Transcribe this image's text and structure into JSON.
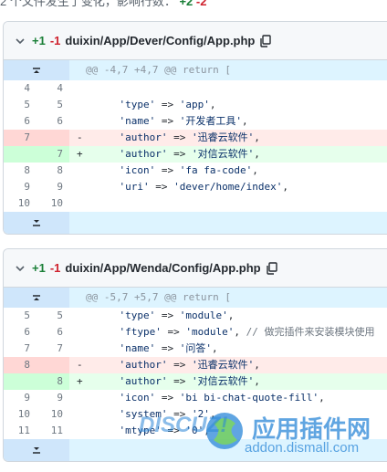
{
  "summary": {
    "prefix": "2 个文件发生了变化，影响行数：",
    "additions": "+2",
    "deletions": "-2"
  },
  "files": [
    {
      "additions": "+1",
      "deletions": "-1",
      "path": "duixin/App/Dever/Config/App.php",
      "hunk": "@@ -4,7 +4,7 @@ return [",
      "lines": [
        {
          "type": "ctx",
          "old": "4",
          "new": "4",
          "sign": "",
          "content": ""
        },
        {
          "type": "ctx",
          "old": "5",
          "new": "5",
          "sign": "",
          "content": "    'type' => 'app',"
        },
        {
          "type": "ctx",
          "old": "6",
          "new": "6",
          "sign": "",
          "content": "    'name' => '开发者工具',"
        },
        {
          "type": "del",
          "old": "7",
          "new": "",
          "sign": "-",
          "content": "    'author' => '迅睿云软件',"
        },
        {
          "type": "add",
          "old": "",
          "new": "7",
          "sign": "+",
          "content": "    'author' => '对信云软件',"
        },
        {
          "type": "ctx",
          "old": "8",
          "new": "8",
          "sign": "",
          "content": "    'icon' => 'fa fa-code',"
        },
        {
          "type": "ctx",
          "old": "9",
          "new": "9",
          "sign": "",
          "content": "    'uri' => 'dever/home/index',"
        },
        {
          "type": "ctx",
          "old": "10",
          "new": "10",
          "sign": "",
          "content": ""
        }
      ]
    },
    {
      "additions": "+1",
      "deletions": "-1",
      "path": "duixin/App/Wenda/Config/App.php",
      "hunk": "@@ -5,7 +5,7 @@ return [",
      "lines": [
        {
          "type": "ctx",
          "old": "5",
          "new": "5",
          "sign": "",
          "content": "    'type' => 'module',"
        },
        {
          "type": "ctx",
          "old": "6",
          "new": "6",
          "sign": "",
          "content": "    'ftype' => 'module', // 做完插件来安装模块使用"
        },
        {
          "type": "ctx",
          "old": "7",
          "new": "7",
          "sign": "",
          "content": "    'name' => '问答',"
        },
        {
          "type": "del",
          "old": "8",
          "new": "",
          "sign": "-",
          "content": "    'author' => '迅睿云软件',"
        },
        {
          "type": "add",
          "old": "",
          "new": "8",
          "sign": "+",
          "content": "    'author' => '对信云软件',"
        },
        {
          "type": "ctx",
          "old": "9",
          "new": "9",
          "sign": "",
          "content": "    'icon' => 'bi bi-chat-quote-fill',"
        },
        {
          "type": "ctx",
          "old": "10",
          "new": "10",
          "sign": "",
          "content": "    'system' => '2',"
        },
        {
          "type": "ctx",
          "old": "11",
          "new": "11",
          "sign": "",
          "content": "    'mtype' => '0',"
        }
      ]
    }
  ],
  "watermark": {
    "brand": "DISCUZ!",
    "title": "应用插件网",
    "url": "addon.dismall.com"
  },
  "colors": {
    "addition": "#1a7f37",
    "deletion": "#cf222e",
    "hunk_bg": "#ddf4ff",
    "expander_bg": "#cfe6fb"
  },
  "icons": {
    "collapse": "chevron-down-icon",
    "copy": "copy-icon",
    "expand_up": "expand-up-icon",
    "expand_down": "expand-down-icon"
  }
}
